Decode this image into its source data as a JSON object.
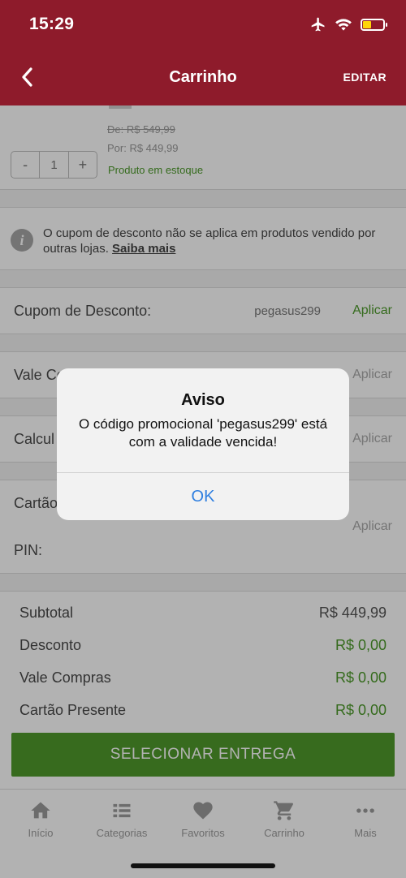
{
  "status_bar": {
    "time": "15:29"
  },
  "header": {
    "title": "Carrinho",
    "edit_label": "EDITAR"
  },
  "product": {
    "qty_minus": "-",
    "qty_value": "1",
    "qty_plus": "+",
    "price_old": "De: R$ 549,99",
    "price_now": "Por: R$ 449,99",
    "stock": "Produto em estoque"
  },
  "notice": {
    "text": "O cupom de desconto não se aplica em produtos vendido por outras lojas.",
    "link": "Saiba mais"
  },
  "coupon": {
    "label": "Cupom de Desconto:",
    "value": "pegasus299",
    "action": "Aplicar"
  },
  "voucher": {
    "label": "Vale Co",
    "action": "Aplicar"
  },
  "shipping": {
    "label": "Calcul",
    "action": "Aplicar"
  },
  "gift_card": {
    "label": "Cartão",
    "pin_label": "PIN:",
    "action": "Aplicar"
  },
  "summary": {
    "rows": [
      {
        "label": "Subtotal",
        "value": "R$ 449,99"
      },
      {
        "label": "Desconto",
        "value": "R$ 0,00"
      },
      {
        "label": "Vale Compras",
        "value": "R$ 0,00"
      },
      {
        "label": "Cartão Presente",
        "value": "R$ 0,00"
      }
    ]
  },
  "cta": {
    "label": "SELECIONAR ENTREGA"
  },
  "tabs": [
    {
      "label": "Início",
      "icon": "home-icon"
    },
    {
      "label": "Categorias",
      "icon": "list-icon"
    },
    {
      "label": "Favoritos",
      "icon": "heart-icon"
    },
    {
      "label": "Carrinho",
      "icon": "cart-icon"
    },
    {
      "label": "Mais",
      "icon": "more-icon"
    }
  ],
  "alert": {
    "title": "Aviso",
    "message": "O código promocional 'pegasus299' está com a validade vencida!",
    "ok": "OK"
  },
  "colors": {
    "brand": "#8e1b2b",
    "accent_green": "#4f9a2b",
    "link_blue": "#2f7fe0"
  }
}
